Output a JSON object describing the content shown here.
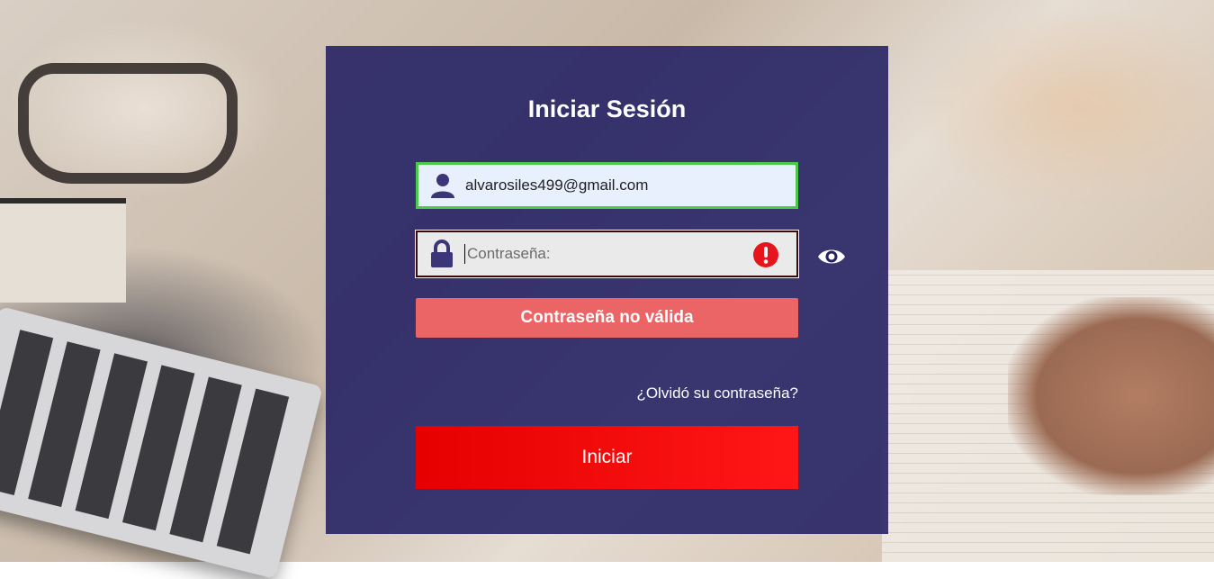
{
  "form": {
    "title": "Iniciar Sesión",
    "email_value": "alvarosiles499@gmail.com",
    "password_placeholder": "Contraseña:",
    "error_message": "Contraseña no válida",
    "forgot_link": "¿Olvidó su contraseña?",
    "submit_label": "Iniciar"
  },
  "icons": {
    "email": "user-icon",
    "password": "lock-icon",
    "error": "error-icon",
    "toggle": "eye-icon"
  },
  "colors": {
    "card": "#262264",
    "valid_border": "#4cc94c",
    "error_banner": "#eb6466",
    "error_icon": "#e8141b",
    "button": "#ff1717"
  }
}
